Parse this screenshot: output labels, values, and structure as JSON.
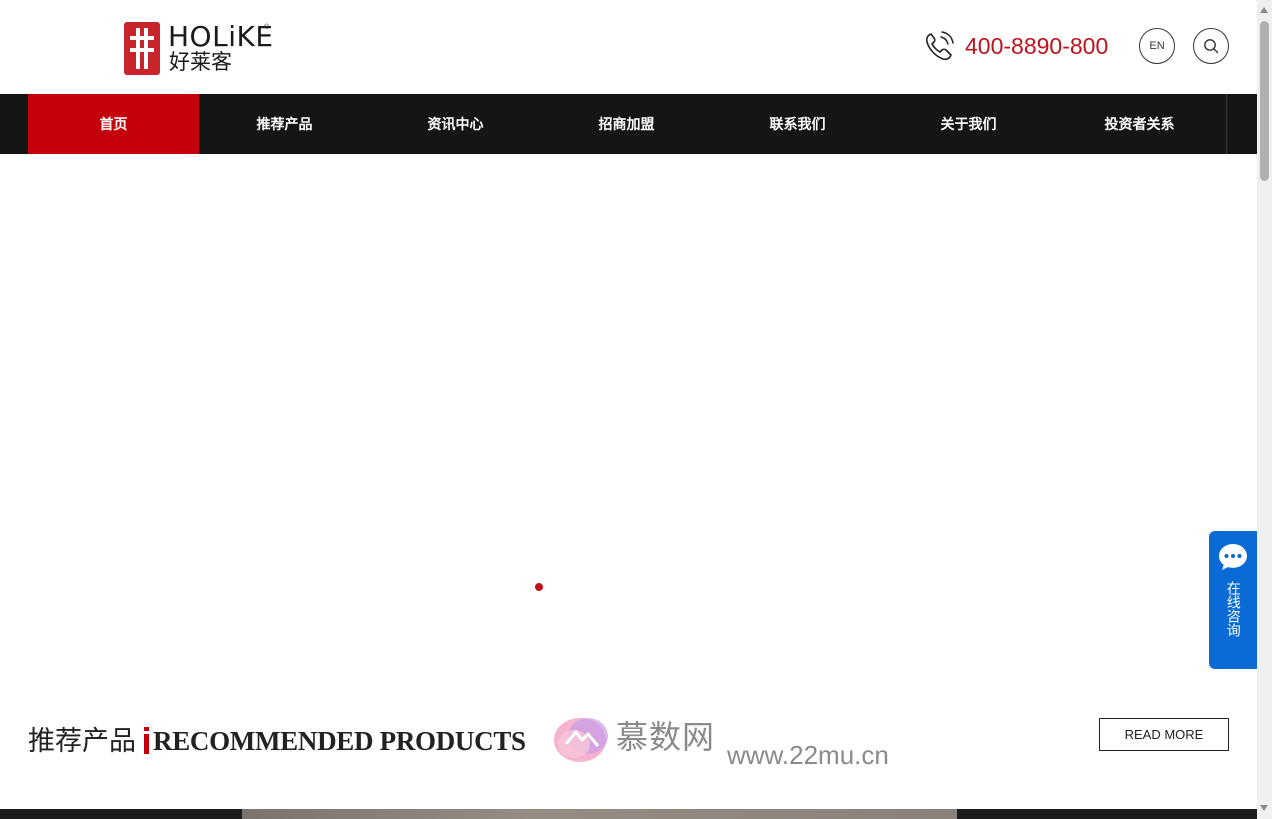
{
  "header": {
    "logo_en": "HOLiKE",
    "logo_cn": "好莱客",
    "logo_registered": "®",
    "hotline": "400-8890-800",
    "lang_button": "EN"
  },
  "nav": {
    "items": [
      {
        "label": "首页",
        "active": true
      },
      {
        "label": "推荐产品",
        "active": false
      },
      {
        "label": "资讯中心",
        "active": false
      },
      {
        "label": "招商加盟",
        "active": false
      },
      {
        "label": "联系我们",
        "active": false
      },
      {
        "label": "关于我们",
        "active": false
      },
      {
        "label": "投资者关系",
        "active": false
      }
    ]
  },
  "banner": {
    "slide_count": 1,
    "active_slide": 1
  },
  "section": {
    "title_cn": "推荐产品",
    "title_en": "RECOMMENDED PRODUCTS",
    "read_more": "READ MORE"
  },
  "watermark": {
    "cn": "慕数网",
    "url": "www.22mu.cn"
  },
  "chat_float": {
    "label": "在线咨询"
  },
  "icons": {
    "phone": "phone-icon",
    "search": "search-icon",
    "chat": "chat-bubble-icon"
  },
  "colors": {
    "brand_red": "#c5000d",
    "hotline_red": "#c0121c",
    "nav_bg": "#151515",
    "chat_blue": "#0a6ad6"
  }
}
